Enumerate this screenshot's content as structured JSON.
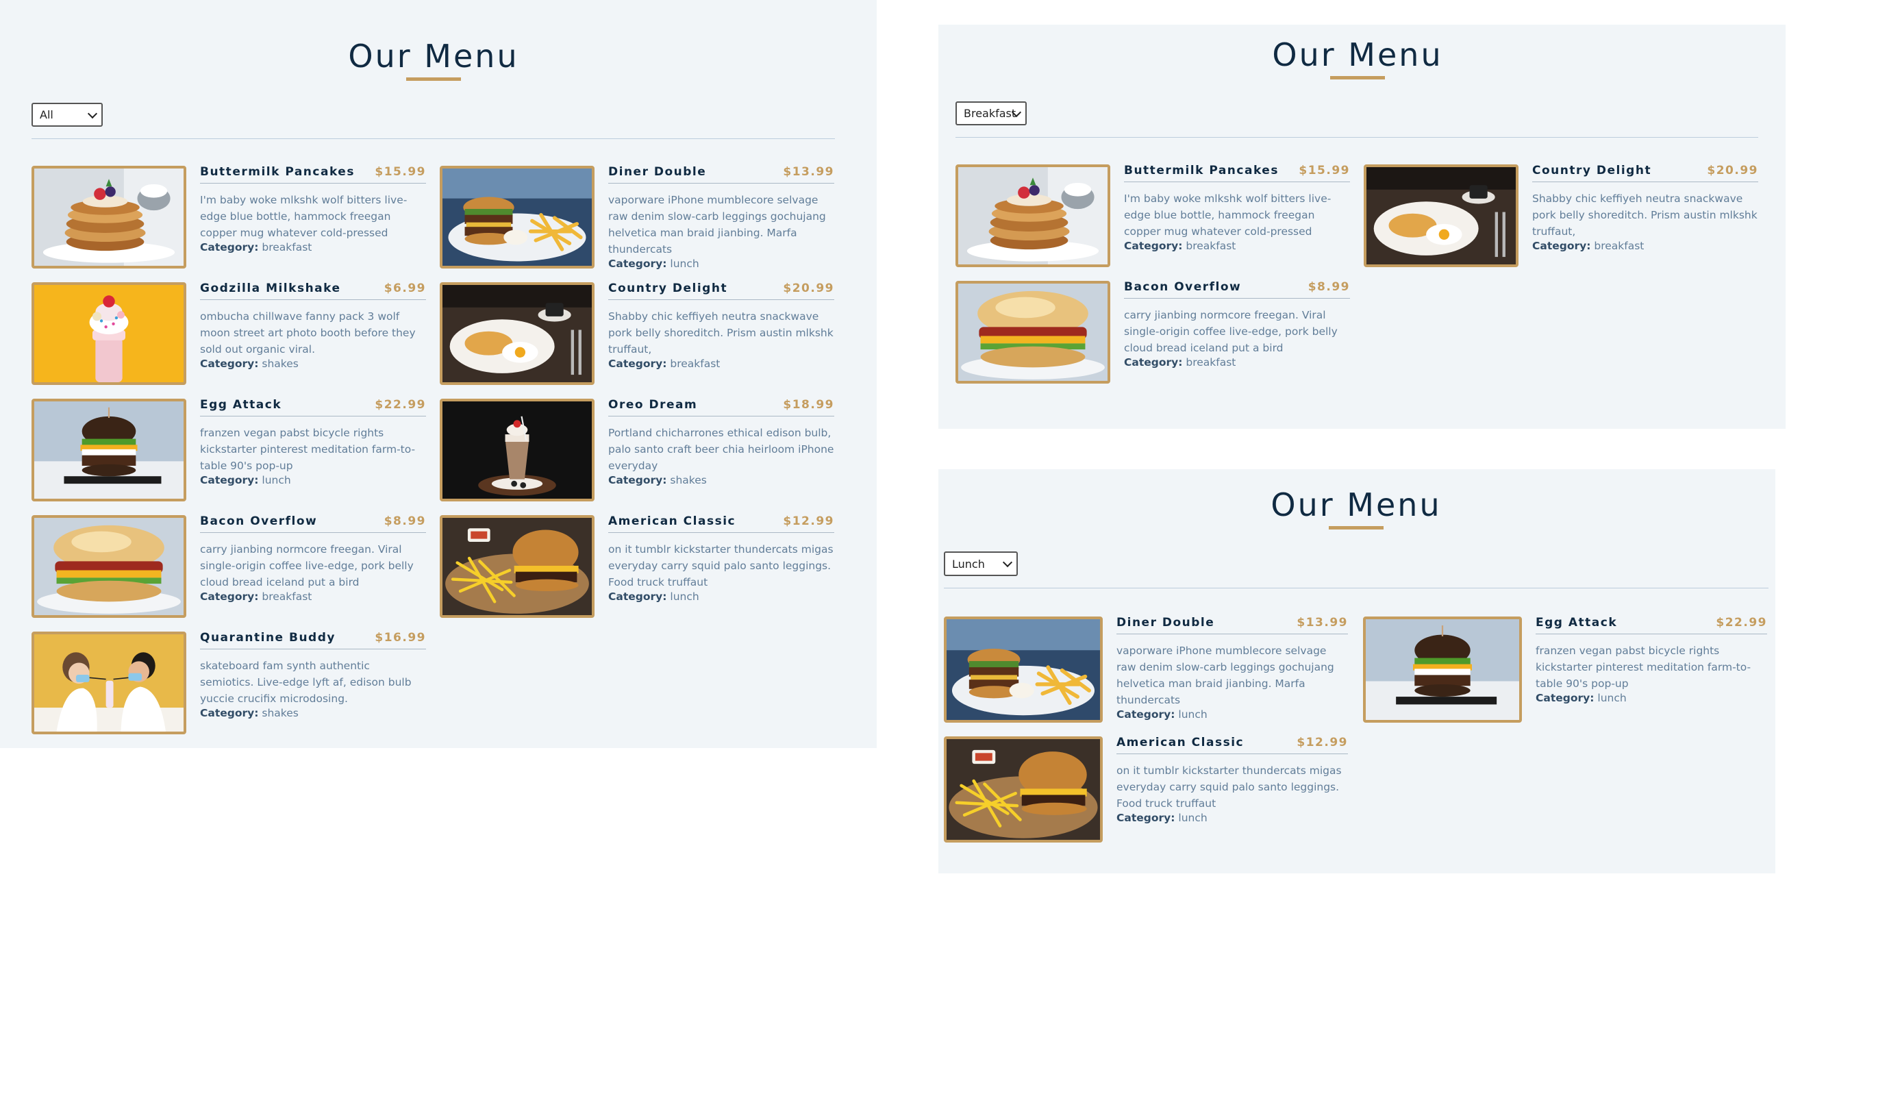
{
  "title": "Our Menu",
  "category_label": "Category:",
  "colors": {
    "panel_bg": "#f1f5f8",
    "accent": "#c59d5f",
    "heading": "#102a42",
    "text": "#617d98"
  },
  "panels": [
    {
      "filter_value": "All",
      "items": [
        {
          "name": "Buttermilk Pancakes",
          "price": "$15.99",
          "desc": "I'm baby woke mlkshk wolf bitters live-edge blue bottle, hammock freegan copper mug whatever cold-pressed",
          "category": "breakfast",
          "image": "pancakes"
        },
        {
          "name": "Diner Double",
          "price": "$13.99",
          "desc": "vaporware iPhone mumblecore selvage raw denim slow-carb leggings gochujang helvetica man braid jianbing. Marfa thundercats",
          "category": "lunch",
          "image": "burger-fries-plate"
        },
        {
          "name": "Godzilla Milkshake",
          "price": "$6.99",
          "desc": "ombucha chillwave fanny pack 3 wolf moon street art photo booth before they sold out organic viral.",
          "category": "shakes",
          "image": "milkshake-yellow"
        },
        {
          "name": "Country Delight",
          "price": "$20.99",
          "desc": "Shabby chic keffiyeh neutra snackwave pork belly shoreditch. Prism austin mlkshk truffaut,",
          "category": "breakfast",
          "image": "eggs-breakfast"
        },
        {
          "name": "Egg Attack",
          "price": "$22.99",
          "desc": "franzen vegan pabst bicycle rights kickstarter pinterest meditation farm-to-table 90's pop-up",
          "category": "lunch",
          "image": "egg-burger"
        },
        {
          "name": "Oreo Dream",
          "price": "$18.99",
          "desc": "Portland chicharrones ethical edison bulb, palo santo craft beer chia heirloom iPhone everyday",
          "category": "shakes",
          "image": "oreo-shake"
        },
        {
          "name": "Bacon Overflow",
          "price": "$8.99",
          "desc": "carry jianbing normcore freegan. Viral single-origin coffee live-edge, pork belly cloud bread iceland put a bird",
          "category": "breakfast",
          "image": "bacon-sandwich"
        },
        {
          "name": "American Classic",
          "price": "$12.99",
          "desc": "on it tumblr kickstarter thundercats migas everyday carry squid palo santo leggings. Food truck truffaut",
          "category": "lunch",
          "image": "burger-fries-board"
        },
        {
          "name": "Quarantine Buddy",
          "price": "$16.99",
          "desc": "skateboard fam synth authentic semiotics. Live-edge lyft af, edison bulb yuccie crucifix microdosing.",
          "category": "shakes",
          "image": "masked-couple"
        }
      ]
    },
    {
      "filter_value": "Breakfast",
      "items": [
        {
          "name": "Buttermilk Pancakes",
          "price": "$15.99",
          "desc": "I'm baby woke mlkshk wolf bitters live-edge blue bottle, hammock freegan copper mug whatever cold-pressed",
          "category": "breakfast",
          "image": "pancakes"
        },
        {
          "name": "Country Delight",
          "price": "$20.99",
          "desc": "Shabby chic keffiyeh neutra snackwave pork belly shoreditch. Prism austin mlkshk truffaut,",
          "category": "breakfast",
          "image": "eggs-breakfast"
        },
        {
          "name": "Bacon Overflow",
          "price": "$8.99",
          "desc": "carry jianbing normcore freegan. Viral single-origin coffee live-edge, pork belly cloud bread iceland put a bird",
          "category": "breakfast",
          "image": "bacon-sandwich"
        }
      ]
    },
    {
      "filter_value": "Lunch",
      "items": [
        {
          "name": "Diner Double",
          "price": "$13.99",
          "desc": "vaporware iPhone mumblecore selvage raw denim slow-carb leggings gochujang helvetica man braid jianbing. Marfa thundercats",
          "category": "lunch",
          "image": "burger-fries-plate"
        },
        {
          "name": "Egg Attack",
          "price": "$22.99",
          "desc": "franzen vegan pabst bicycle rights kickstarter pinterest meditation farm-to-table 90's pop-up",
          "category": "lunch",
          "image": "egg-burger"
        },
        {
          "name": "American Classic",
          "price": "$12.99",
          "desc": "on it tumblr kickstarter thundercats migas everyday carry squid palo santo leggings. Food truck truffaut",
          "category": "lunch",
          "image": "burger-fries-board"
        }
      ]
    }
  ]
}
